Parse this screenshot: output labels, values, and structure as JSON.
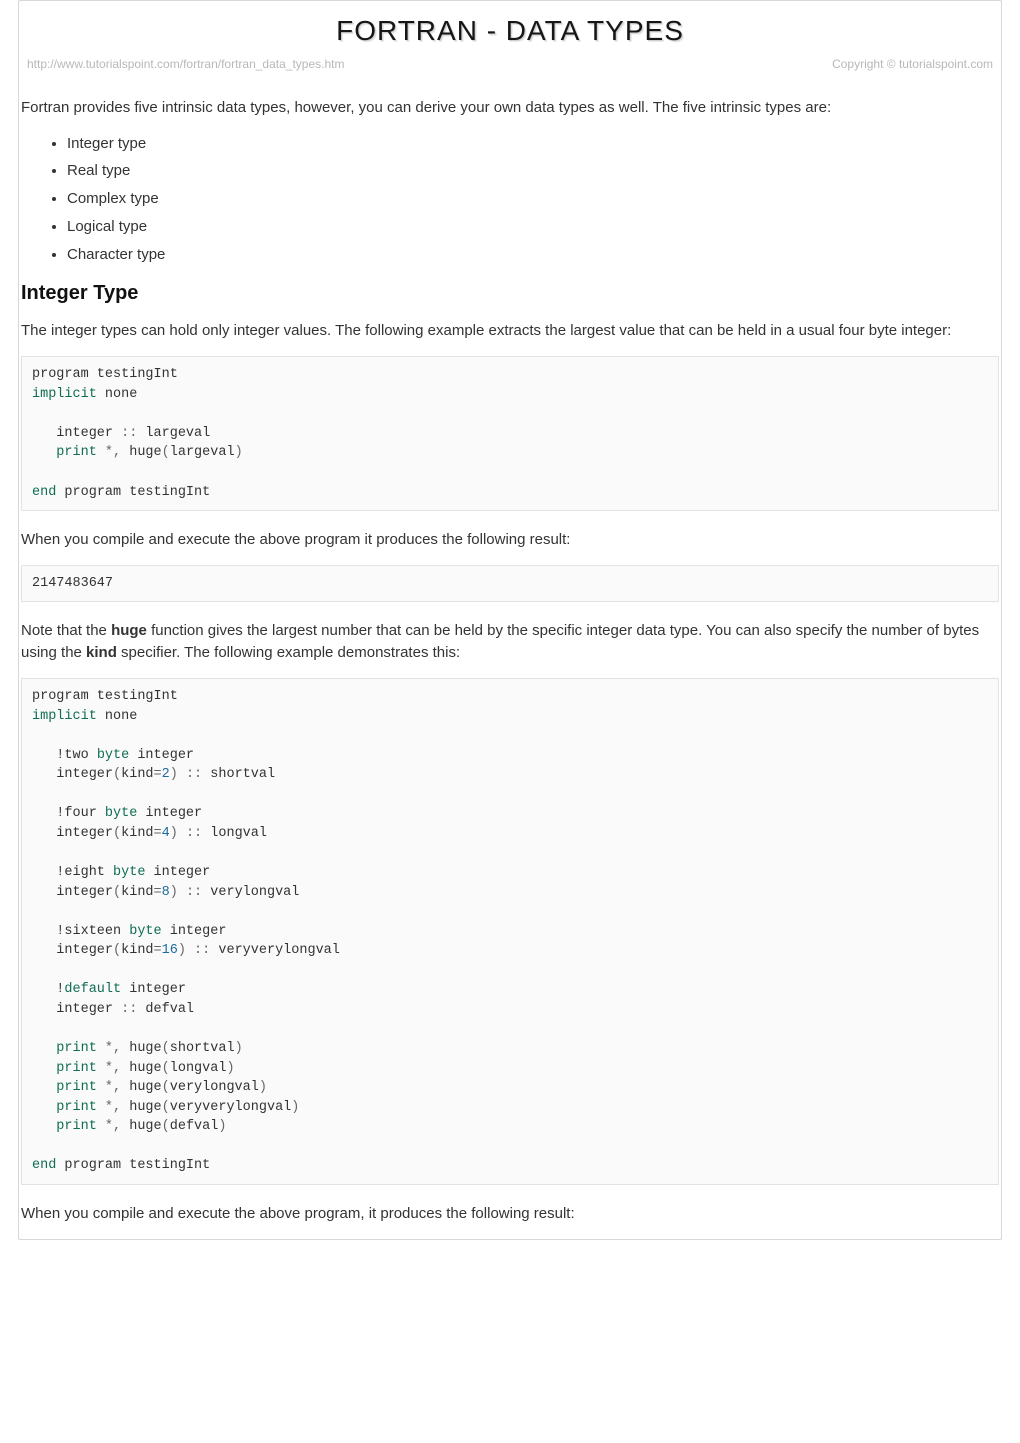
{
  "title": "FORTRAN - DATA TYPES",
  "source_url": "http://www.tutorialspoint.com/fortran/fortran_data_types.htm",
  "copyright": "Copyright © tutorialspoint.com",
  "intro_para": "Fortran provides five intrinsic data types, however, you can derive your own data types as well. The five intrinsic types are:",
  "types_list": [
    "Integer type",
    "Real type",
    "Complex type",
    "Logical type",
    "Character type"
  ],
  "section_integer_heading": "Integer Type",
  "integer_para": "The integer types can hold only integer values. The following example extracts the largest value that can be held in a usual four byte integer:",
  "code1": {
    "l1_a": "program testingInt",
    "l2_a": "implicit",
    "l2_b": " none",
    "l3_a": "   integer ",
    "l3_b": "::",
    "l3_c": " largeval",
    "l4_a": "   print ",
    "l4_b": "*,",
    "l4_c": " huge",
    "l4_d": "(",
    "l4_e": "largeval",
    "l4_f": ")",
    "l5_a": "end",
    "l5_b": " program testingInt"
  },
  "result_intro1": "When you compile and execute the above program it produces the following result:",
  "output1": "2147483647",
  "note_para_pre": "Note that the ",
  "note_bold1": "huge",
  "note_para_mid": " function gives the largest number that can be held by the specific integer data type. You can also specify the number of bytes using the ",
  "note_bold2": "kind",
  "note_para_post": " specifier. The following example demonstrates this:",
  "code2": {
    "l01": "program testingInt",
    "l02a": "implicit",
    "l02b": " none",
    "l03_excl": "   !",
    "l03a": "two ",
    "l03b": "byte",
    "l03c": " integer",
    "l04a": "   integer",
    "l04b": "(",
    "l04c": "kind",
    "l04d": "=",
    "l04e": "2",
    "l04f": ")",
    "l04g": " ::",
    "l04h": " shortval",
    "l05_excl": "   !",
    "l05a": "four ",
    "l05b": "byte",
    "l05c": " integer",
    "l06a": "   integer",
    "l06b": "(",
    "l06c": "kind",
    "l06d": "=",
    "l06e": "4",
    "l06f": ")",
    "l06g": " ::",
    "l06h": " longval",
    "l07_excl": "   !",
    "l07a": "eight ",
    "l07b": "byte",
    "l07c": " integer",
    "l08a": "   integer",
    "l08b": "(",
    "l08c": "kind",
    "l08d": "=",
    "l08e": "8",
    "l08f": ")",
    "l08g": " ::",
    "l08h": " verylongval",
    "l09_excl": "   !",
    "l09a": "sixteen ",
    "l09b": "byte",
    "l09c": " integer",
    "l10a": "   integer",
    "l10b": "(",
    "l10c": "kind",
    "l10d": "=",
    "l10e": "16",
    "l10f": ")",
    "l10g": " ::",
    "l10h": " veryverylongval",
    "l11_excl": "   !",
    "l11a": "default",
    "l11b": " integer",
    "l12a": "   integer ",
    "l12b": "::",
    "l12c": " defval",
    "p1a": "   print ",
    "p1b": "*,",
    "p1c": " huge",
    "p1d": "(",
    "p1e": "shortval",
    "p1f": ")",
    "p2a": "   print ",
    "p2b": "*,",
    "p2c": " huge",
    "p2d": "(",
    "p2e": "longval",
    "p2f": ")",
    "p3a": "   print ",
    "p3b": "*,",
    "p3c": " huge",
    "p3d": "(",
    "p3e": "verylongval",
    "p3f": ")",
    "p4a": "   print ",
    "p4b": "*,",
    "p4c": " huge",
    "p4d": "(",
    "p4e": "veryverylongval",
    "p4f": ")",
    "p5a": "   print ",
    "p5b": "*,",
    "p5c": " huge",
    "p5d": "(",
    "p5e": "defval",
    "p5f": ")",
    "enda": "end",
    "endb": " program testingInt"
  },
  "result_intro2": "When you compile and execute the above program, it produces the following result:"
}
